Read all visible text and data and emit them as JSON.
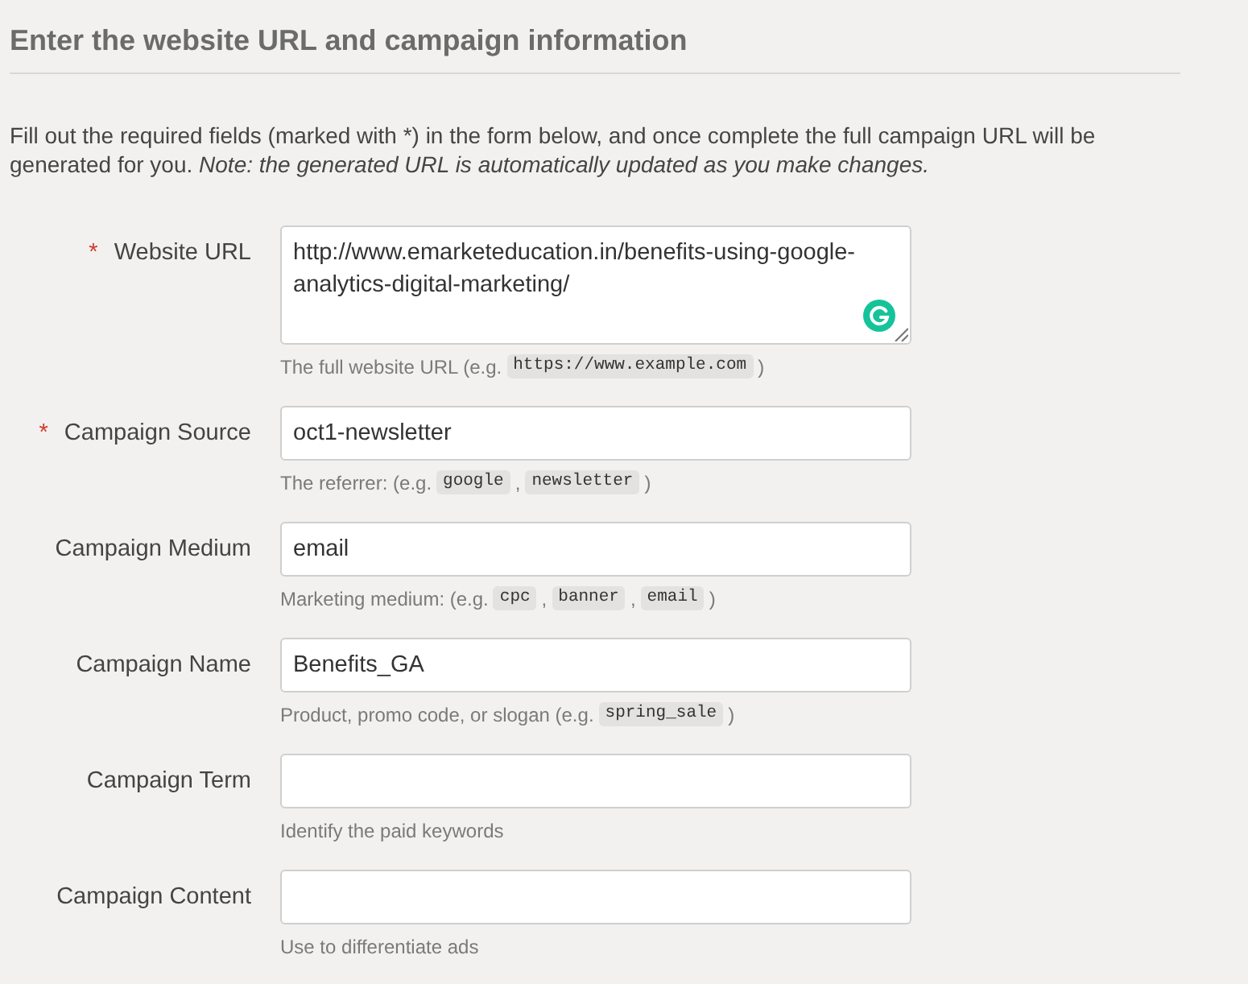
{
  "heading": {
    "title": "Enter the website URL and campaign information"
  },
  "intro": {
    "text": "Fill out the required fields (marked with *) in the form below, and once complete the full campaign URL will be generated for you.",
    "note": "Note: the generated URL is automatically updated as you make changes."
  },
  "fields": [
    {
      "kind": "textarea",
      "label": "Website URL",
      "required_mark": "*",
      "value": "http://www.emarketeducation.in/benefits-using-google-analytics-digital-marketing/",
      "hint": [
        {
          "kind": "text",
          "text": "The full website URL (e.g."
        },
        {
          "kind": "code",
          "text": "https://www.example.com"
        },
        {
          "kind": "text",
          "text": ")"
        }
      ]
    },
    {
      "kind": "text",
      "label": "Campaign Source",
      "required_mark": "*",
      "value": "oct1-newsletter",
      "hint": [
        {
          "kind": "text",
          "text": "The referrer: (e.g."
        },
        {
          "kind": "code",
          "text": "google"
        },
        {
          "kind": "text",
          "text": ","
        },
        {
          "kind": "code",
          "text": "newsletter"
        },
        {
          "kind": "text",
          "text": ")"
        }
      ]
    },
    {
      "kind": "text",
      "label": "Campaign Medium",
      "value": "email",
      "hint": [
        {
          "kind": "text",
          "text": "Marketing medium: (e.g."
        },
        {
          "kind": "code",
          "text": "cpc"
        },
        {
          "kind": "text",
          "text": ","
        },
        {
          "kind": "code",
          "text": "banner"
        },
        {
          "kind": "text",
          "text": ","
        },
        {
          "kind": "code",
          "text": "email"
        },
        {
          "kind": "text",
          "text": ")"
        }
      ]
    },
    {
      "kind": "text",
      "label": "Campaign Name",
      "value": "Benefits_GA",
      "hint": [
        {
          "kind": "text",
          "text": "Product, promo code, or slogan (e.g."
        },
        {
          "kind": "code",
          "text": "spring_sale"
        },
        {
          "kind": "text",
          "text": ")"
        }
      ]
    },
    {
      "kind": "text",
      "label": "Campaign Term",
      "hint": [
        {
          "kind": "text",
          "text": "Identify the paid keywords"
        }
      ]
    },
    {
      "kind": "text",
      "label": "Campaign Content",
      "hint": [
        {
          "kind": "text",
          "text": "Use to differentiate ads"
        }
      ]
    }
  ]
}
